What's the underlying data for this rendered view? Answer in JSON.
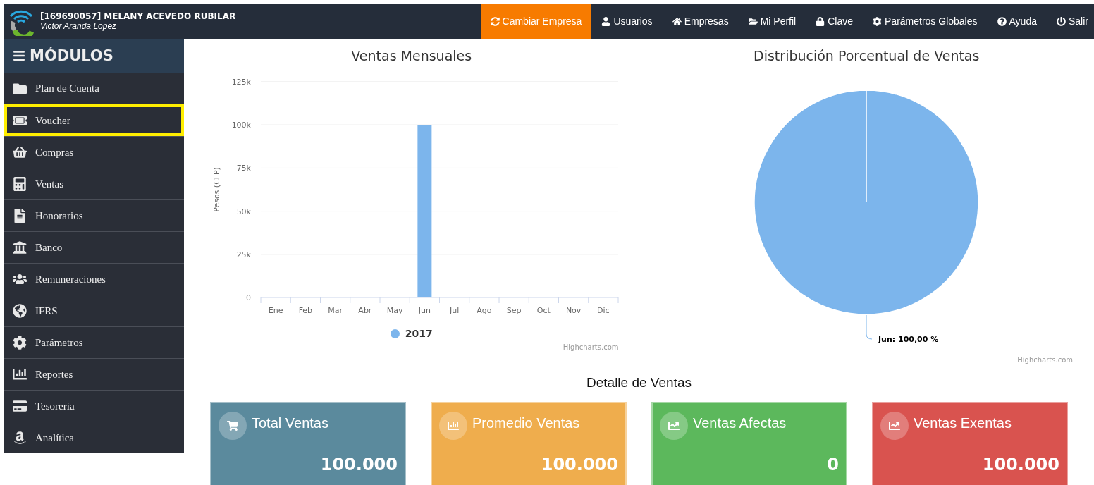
{
  "header": {
    "account": "[169690057] MELANY ACEVEDO RUBILAR",
    "user": "Victor Aranda Lopez"
  },
  "nav": [
    {
      "label": "Cambiar Empresa",
      "selected": true
    },
    {
      "label": "Usuarios",
      "selected": false
    },
    {
      "label": "Empresas",
      "selected": false
    },
    {
      "label": "Mi Perfil",
      "selected": false
    },
    {
      "label": "Clave",
      "selected": false
    },
    {
      "label": "Parámetros Globales",
      "selected": false
    },
    {
      "label": "Ayuda",
      "selected": false
    },
    {
      "label": "Salir",
      "selected": false
    }
  ],
  "sidebar": {
    "title": "MÓDULOS",
    "items": [
      {
        "label": "Plan de Cuenta",
        "selected": false
      },
      {
        "label": "Voucher",
        "selected": true
      },
      {
        "label": "Compras",
        "selected": false
      },
      {
        "label": "Ventas",
        "selected": false
      },
      {
        "label": "Honorarios",
        "selected": false
      },
      {
        "label": "Banco",
        "selected": false
      },
      {
        "label": "Remuneraciones",
        "selected": false
      },
      {
        "label": "IFRS",
        "selected": false
      },
      {
        "label": "Parámetros",
        "selected": false
      },
      {
        "label": "Reportes",
        "selected": false
      },
      {
        "label": "Tesoreria",
        "selected": false
      },
      {
        "label": "Analítica",
        "selected": false
      }
    ]
  },
  "sales_chart": {
    "credits": "Highcharts.com",
    "chart_data": {
      "type": "bar",
      "title": "Ventas Mensuales",
      "ylabel": "Pesos (CLP)",
      "categories": [
        "Ene",
        "Feb",
        "Mar",
        "Abr",
        "May",
        "Jun",
        "Jul",
        "Ago",
        "Sep",
        "Oct",
        "Nov",
        "Dic"
      ],
      "series": [
        {
          "name": "2017",
          "color": "#7cb5ec",
          "values": [
            0,
            0,
            0,
            0,
            0,
            100000,
            0,
            0,
            0,
            0,
            0,
            0
          ]
        }
      ],
      "ylim": [
        0,
        125000
      ],
      "grid": true,
      "yticks": [
        {
          "value": 0,
          "label": "0"
        },
        {
          "value": 25000,
          "label": "25k"
        },
        {
          "value": 50000,
          "label": "50k"
        },
        {
          "value": 75000,
          "label": "75k"
        },
        {
          "value": 100000,
          "label": "100k"
        },
        {
          "value": 125000,
          "label": "125k"
        }
      ]
    }
  },
  "distribution_chart": {
    "credits": "Highcharts.com",
    "chart_data": {
      "type": "pie",
      "title": "Distribución Porcentual de Ventas",
      "categories": [
        "Jun"
      ],
      "values": [
        100
      ],
      "value_labels": [
        "100,00 %"
      ]
    }
  },
  "detail": {
    "title": "Detalle de Ventas",
    "cards": [
      {
        "title": "Total Ventas",
        "value": "100.000",
        "color": "#5b8a9d"
      },
      {
        "title": "Promedio Ventas",
        "value": "100.000",
        "color": "#efad4d"
      },
      {
        "title": "Ventas Afectas",
        "value": "0",
        "color": "#5cb85c"
      },
      {
        "title": "Ventas Exentas",
        "value": "100.000",
        "color": "#d9534f"
      }
    ]
  }
}
